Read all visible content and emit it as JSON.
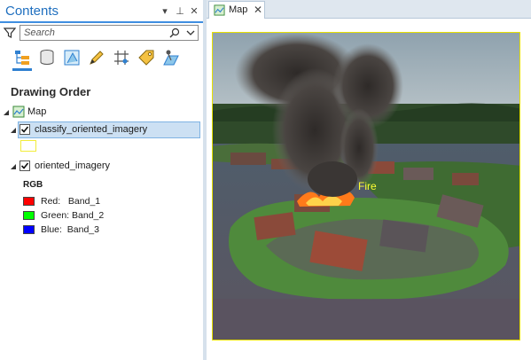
{
  "contents": {
    "title": "Contents",
    "header_buttons": {
      "options": "▾",
      "pin": "⊥",
      "close": "✕"
    },
    "search": {
      "placeholder": "Search",
      "value": ""
    },
    "toolbar": [
      {
        "name": "list-by-drawing-order",
        "icon": "drawing-order-icon",
        "selected": true
      },
      {
        "name": "list-by-data-source",
        "icon": "database-icon",
        "selected": false
      },
      {
        "name": "list-by-selection",
        "icon": "selection-icon",
        "selected": false
      },
      {
        "name": "list-by-editing",
        "icon": "pencil-icon",
        "selected": false
      },
      {
        "name": "list-by-snapping",
        "icon": "snapping-icon",
        "selected": false
      },
      {
        "name": "list-by-labeling",
        "icon": "label-tag-icon",
        "selected": false
      },
      {
        "name": "list-by-perspective-imagery",
        "icon": "perspective-imagery-icon",
        "selected": false
      }
    ],
    "section_title": "Drawing Order",
    "tree": {
      "map": {
        "label": "Map"
      },
      "layer1": {
        "label": "classify_oriented_imagery",
        "checked": true,
        "selected": true,
        "symbol_outline": "#f2ec3a"
      },
      "layer2": {
        "label": "oriented_imagery",
        "checked": true,
        "renderer_title": "RGB",
        "bands": [
          {
            "label": "Red:   Band_1",
            "color": "#ff0000"
          },
          {
            "label": "Green: Band_2",
            "color": "#00ff00"
          },
          {
            "label": "Blue:  Band_3",
            "color": "#0000ff"
          }
        ]
      }
    }
  },
  "map_view": {
    "tab_label": "Map",
    "tab_close": "✕",
    "frame_color": "#e9e200",
    "detection_label": "Fire",
    "detection_color": "#ffff33"
  }
}
